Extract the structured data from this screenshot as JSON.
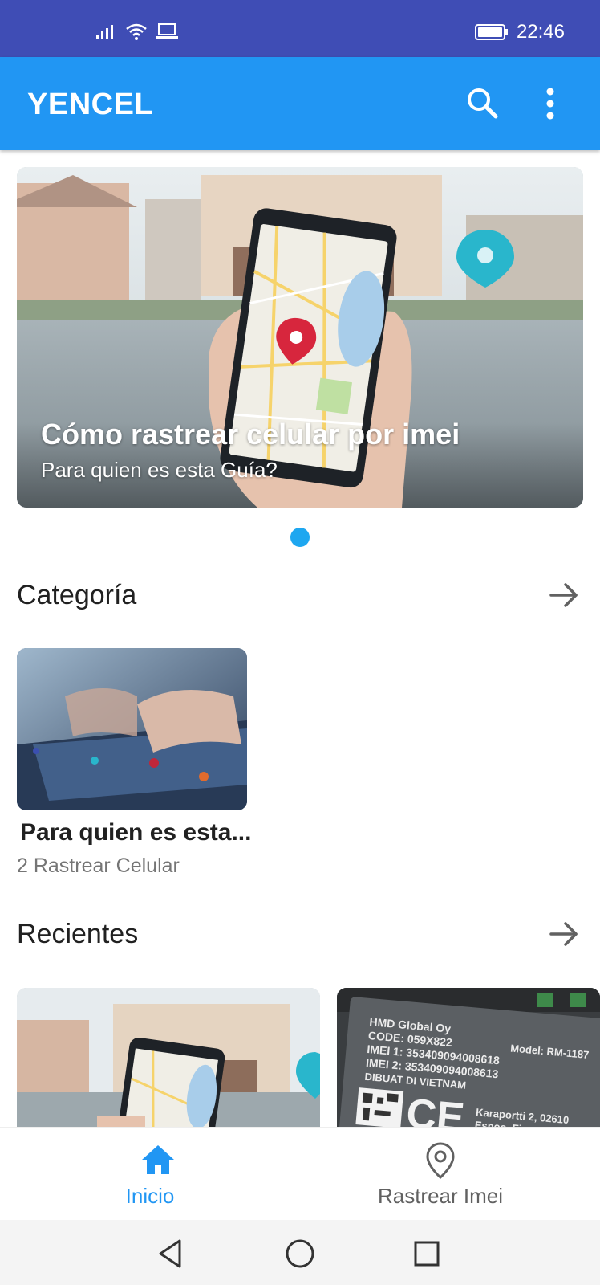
{
  "status_bar": {
    "time": "22:46",
    "icons": [
      "signal-icon",
      "wifi-icon",
      "laptop-icon",
      "battery-icon"
    ]
  },
  "app_bar": {
    "title": "YENCEL",
    "icons": [
      "search-icon",
      "more-vert-icon"
    ]
  },
  "hero": {
    "title": "Cómo rastrear celular por imei",
    "subtitle": "Para quien es esta Guía?"
  },
  "sections": {
    "category": {
      "title": "Categoría",
      "card_title": "Para quien es esta...",
      "card_subtitle": "2 Rastrear Celular"
    },
    "recent": {
      "title": "Recientes",
      "card2_text": {
        "line1": "HMD Global Oy",
        "line2": "CODE: 059X822",
        "line3": "IMEI 1: 353409094008618",
        "line4": "IMEI 2: 353409094008613",
        "line5": "DIBUAT DI VIETNAM",
        "model": "Model: RM-1187",
        "address": "Karaportti 2, 02610",
        "city": "Espoo, Fi"
      }
    }
  },
  "bottom_nav": {
    "items": [
      {
        "label": "Inicio",
        "icon": "home-icon",
        "active": true
      },
      {
        "label": "Rastrear Imei",
        "icon": "location-pin-icon",
        "active": false
      }
    ]
  },
  "colors": {
    "status_bar": "#3f4db5",
    "app_bar": "#2196f3",
    "accent": "#2196f3",
    "indicator": "#1ea7f0"
  }
}
